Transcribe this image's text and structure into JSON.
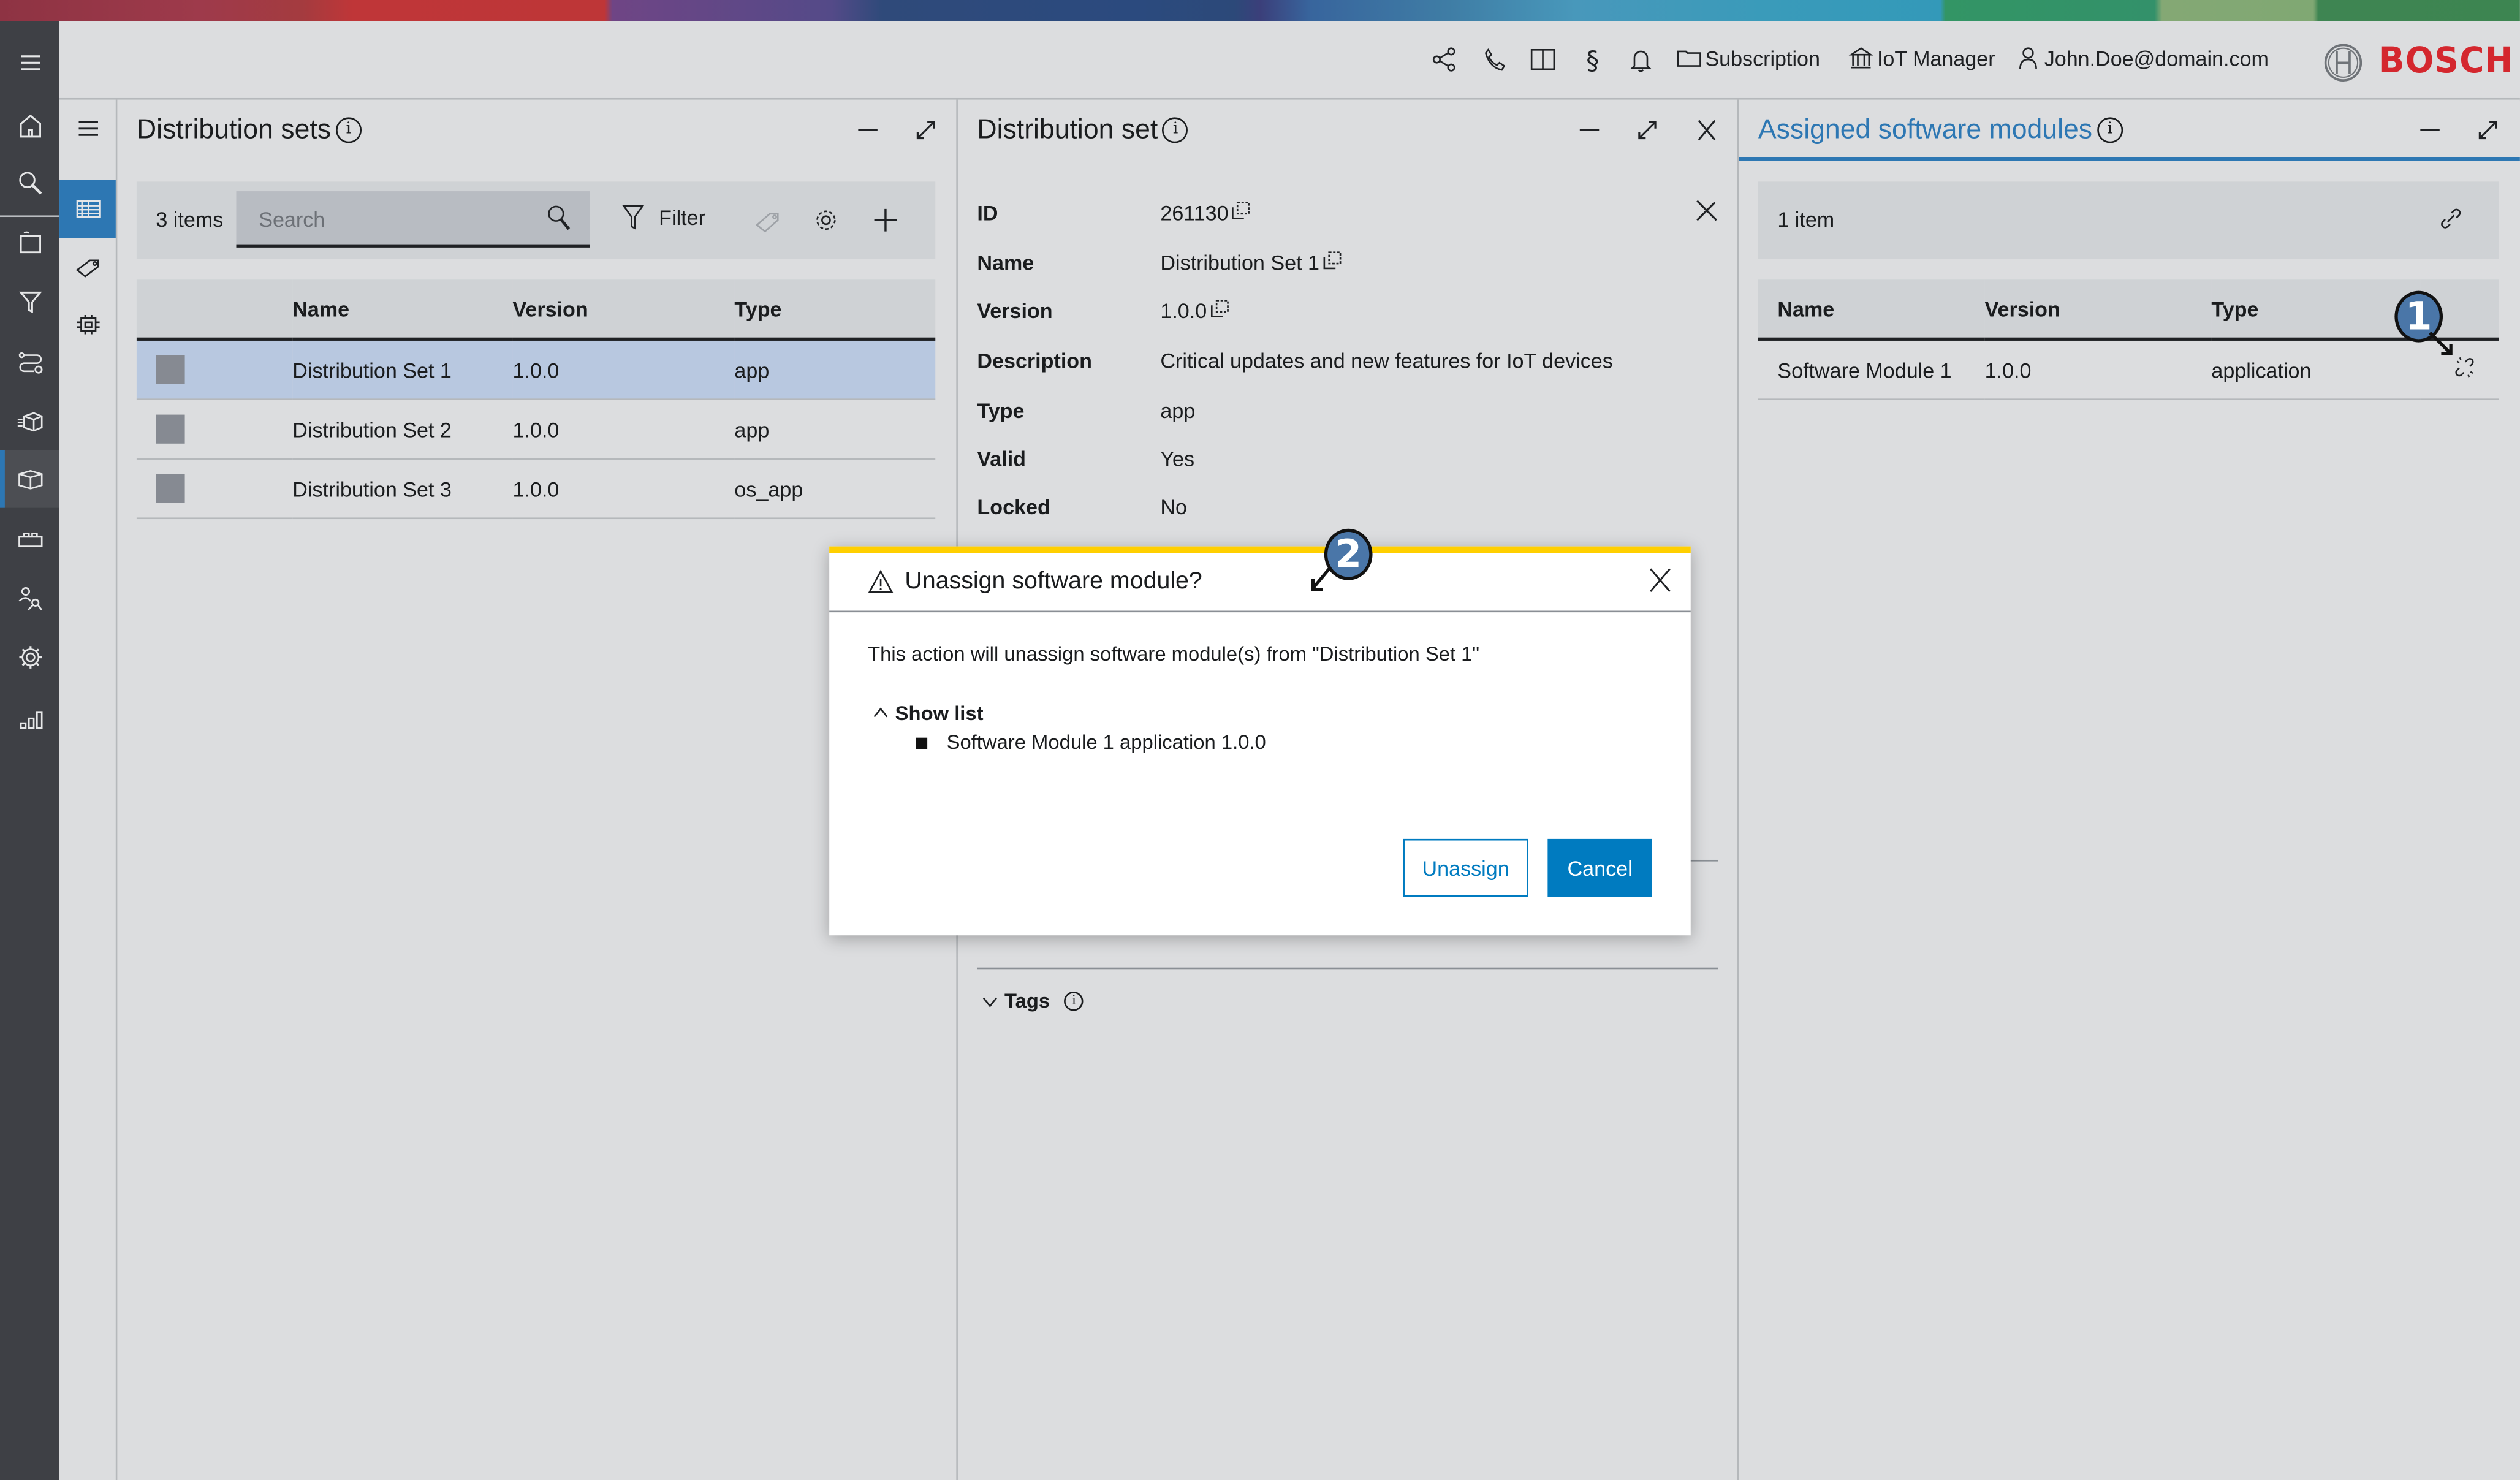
{
  "header": {
    "icons": [
      "share-icon",
      "phone-icon",
      "book-icon",
      "legal-paragraph-icon",
      "bell-icon"
    ],
    "subscription_label": "Subscription",
    "iot_manager_label": "IoT Manager",
    "user_email": "John.Doe@domain.com",
    "brand": "BOSCH"
  },
  "nav": {
    "items": [
      {
        "name": "home",
        "icon": "home-icon"
      },
      {
        "name": "search",
        "icon": "search-icon"
      },
      {
        "name": "devices",
        "icon": "device-folder-icon"
      },
      {
        "name": "filters",
        "icon": "filter-icon"
      },
      {
        "name": "rollouts",
        "icon": "rollout-icon"
      },
      {
        "name": "deployment",
        "icon": "package-deploy-icon"
      },
      {
        "name": "distributions",
        "icon": "box-icon",
        "active": true
      },
      {
        "name": "modules",
        "icon": "brick-icon"
      },
      {
        "name": "access",
        "icon": "user-keys-icon"
      },
      {
        "name": "settings",
        "icon": "gear-icon"
      },
      {
        "name": "statistics",
        "icon": "bar-chart-icon"
      }
    ]
  },
  "subnav": {
    "items": [
      {
        "name": "menu",
        "icon": "hamburger-icon"
      },
      {
        "name": "distribution-sets",
        "icon": "table-icon",
        "active": true
      },
      {
        "name": "tags",
        "icon": "tag-icon"
      },
      {
        "name": "types",
        "icon": "chip-icon"
      }
    ]
  },
  "distribution_sets_panel": {
    "title": "Distribution sets",
    "info": "i",
    "count": "3 items",
    "search_placeholder": "Search",
    "search_value": "",
    "filter_label": "Filter",
    "columns": [
      "",
      "Name",
      "Version",
      "Type"
    ],
    "rows": [
      {
        "name": "Distribution Set 1",
        "version": "1.0.0",
        "type": "app",
        "selected": true
      },
      {
        "name": "Distribution Set 2",
        "version": "1.0.0",
        "type": "app",
        "selected": false
      },
      {
        "name": "Distribution Set 3",
        "version": "1.0.0",
        "type": "os_app",
        "selected": false
      }
    ]
  },
  "distribution_set_panel": {
    "title": "Distribution set",
    "info": "i",
    "fields": [
      {
        "label": "ID",
        "value": "261130",
        "copy": true
      },
      {
        "label": "Name",
        "value": "Distribution Set 1",
        "copy": true
      },
      {
        "label": "Version",
        "value": "1.0.0",
        "copy": true
      },
      {
        "label": "Description",
        "value": "Critical updates and new features for IoT devices",
        "copy": false
      },
      {
        "label": "Type",
        "value": "app",
        "copy": false
      },
      {
        "label": "Valid",
        "value": "Yes",
        "copy": false
      },
      {
        "label": "Locked",
        "value": "No",
        "copy": false
      }
    ],
    "tags_label": "Tags",
    "tags_info": "i"
  },
  "assigned_modules_panel": {
    "title": "Assigned software modules",
    "info": "i",
    "count": "1 item",
    "columns": [
      "Name",
      "Version",
      "Type",
      ""
    ],
    "rows": [
      {
        "name": "Software Module 1",
        "version": "1.0.0",
        "type": "application"
      }
    ],
    "accent_color": "#2d77b3"
  },
  "modal": {
    "title": "Unassign software module?",
    "message": "This action will unassign software module(s) from \"Distribution Set 1\"",
    "toggle_label": "Show list",
    "list_items": [
      "Software Module 1 application 1.0.0"
    ],
    "unassign_label": "Unassign",
    "cancel_label": "Cancel",
    "accent_bar_color": "#ffcf00",
    "primary_color": "#007bc0"
  },
  "annotations": [
    {
      "number": "1",
      "target": "unassign-module-button"
    },
    {
      "number": "2",
      "target": "modal-title"
    }
  ]
}
